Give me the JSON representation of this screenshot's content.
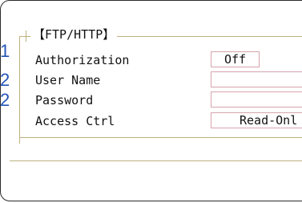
{
  "section": {
    "title": "【FTP/HTTP】"
  },
  "rows": [
    {
      "marker": "1",
      "label": "Authorization",
      "value": "Off"
    },
    {
      "marker": "2",
      "label": "User Name",
      "value": ""
    },
    {
      "marker": "2",
      "label": "Password",
      "value": ""
    },
    {
      "marker": "",
      "label": "Access Ctrl",
      "value": "Read-Onl"
    }
  ]
}
